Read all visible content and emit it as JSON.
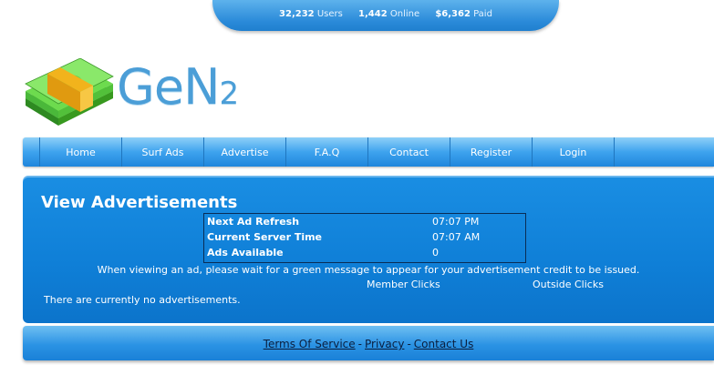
{
  "stats": {
    "users_count": "32,232",
    "users_label": "Users",
    "online_count": "1,442",
    "online_label": "Online",
    "paid_amount": "$6,362",
    "paid_label": "Paid"
  },
  "logo": {
    "text_main": "GeN",
    "text_sub": "2",
    "icon": "money-stack-icon"
  },
  "nav": {
    "items": [
      {
        "label": "Home"
      },
      {
        "label": "Surf Ads"
      },
      {
        "label": "Advertise"
      },
      {
        "label": "F.A.Q"
      },
      {
        "label": "Contact"
      },
      {
        "label": "Register"
      },
      {
        "label": "Login"
      }
    ]
  },
  "main": {
    "title": "View Advertisements",
    "info": [
      {
        "label": "Next Ad Refresh",
        "value": "07:07 PM"
      },
      {
        "label": "Current Server Time",
        "value": "07:07 AM"
      },
      {
        "label": "Ads Available",
        "value": "0"
      }
    ],
    "wait_message": "When viewing an ad, please wait for a green message to appear for your advertisement credit to be issued.",
    "member_clicks_label": "Member Clicks",
    "outside_clicks_label": "Outside Clicks",
    "no_ads_message": "There are currently no advertisements."
  },
  "footer": {
    "terms": "Terms Of Service",
    "privacy": "Privacy",
    "contact": "Contact Us",
    "separator": "-"
  },
  "colors": {
    "primary_blue": "#1a8ee3",
    "logo_blue": "#4b9ed7",
    "money_green": "#5fd14a",
    "band_gold": "#f2b31c"
  }
}
